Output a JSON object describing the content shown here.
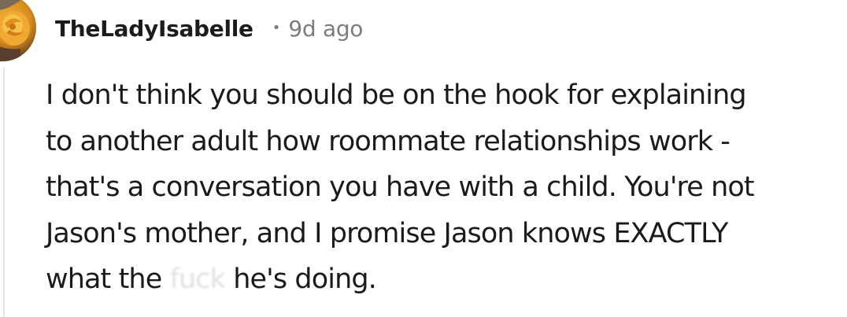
{
  "comment": {
    "avatar_icon": "flower-avatar-icon",
    "username": "TheLadyIsabelle",
    "separator": "•",
    "time_ago": "9d ago",
    "body_lines": [
      "I don't think you should be on the hook for explaining",
      "to another adult how roommate relationships work -",
      "that's a conversation you have with a child. You're not",
      "Jason's mother, and I promise Jason knows EXACTLY"
    ],
    "last_line_before": "what the ",
    "censored_word": "fuck",
    "last_line_after": " he's doing."
  }
}
